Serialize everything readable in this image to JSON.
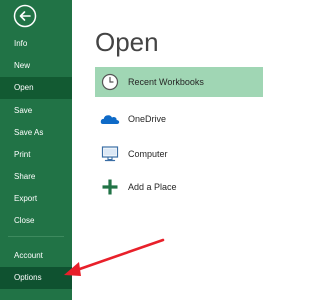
{
  "backstage": {
    "back_icon": "back-arrow-icon",
    "nav_items": [
      {
        "label": "Info"
      },
      {
        "label": "New"
      },
      {
        "label": "Open"
      },
      {
        "label": "Save"
      },
      {
        "label": "Save As"
      },
      {
        "label": "Print"
      },
      {
        "label": "Share"
      },
      {
        "label": "Export"
      },
      {
        "label": "Close"
      },
      {
        "label": "Account"
      },
      {
        "label": "Options"
      }
    ],
    "selected_item": "Open"
  },
  "main": {
    "title": "Open",
    "locations": [
      {
        "label": "Recent Workbooks",
        "icon": "clock-icon",
        "selected": true
      },
      {
        "label": "OneDrive",
        "icon": "cloud-icon",
        "selected": false
      },
      {
        "label": "Computer",
        "icon": "computer-icon",
        "selected": false
      },
      {
        "label": "Add a Place",
        "icon": "plus-icon",
        "selected": false
      }
    ]
  },
  "colors": {
    "sidebar": "#217346",
    "selected_nav": "#125a32",
    "selected_location": "#a0d6b4",
    "annotation_arrow": "#e8202a"
  }
}
